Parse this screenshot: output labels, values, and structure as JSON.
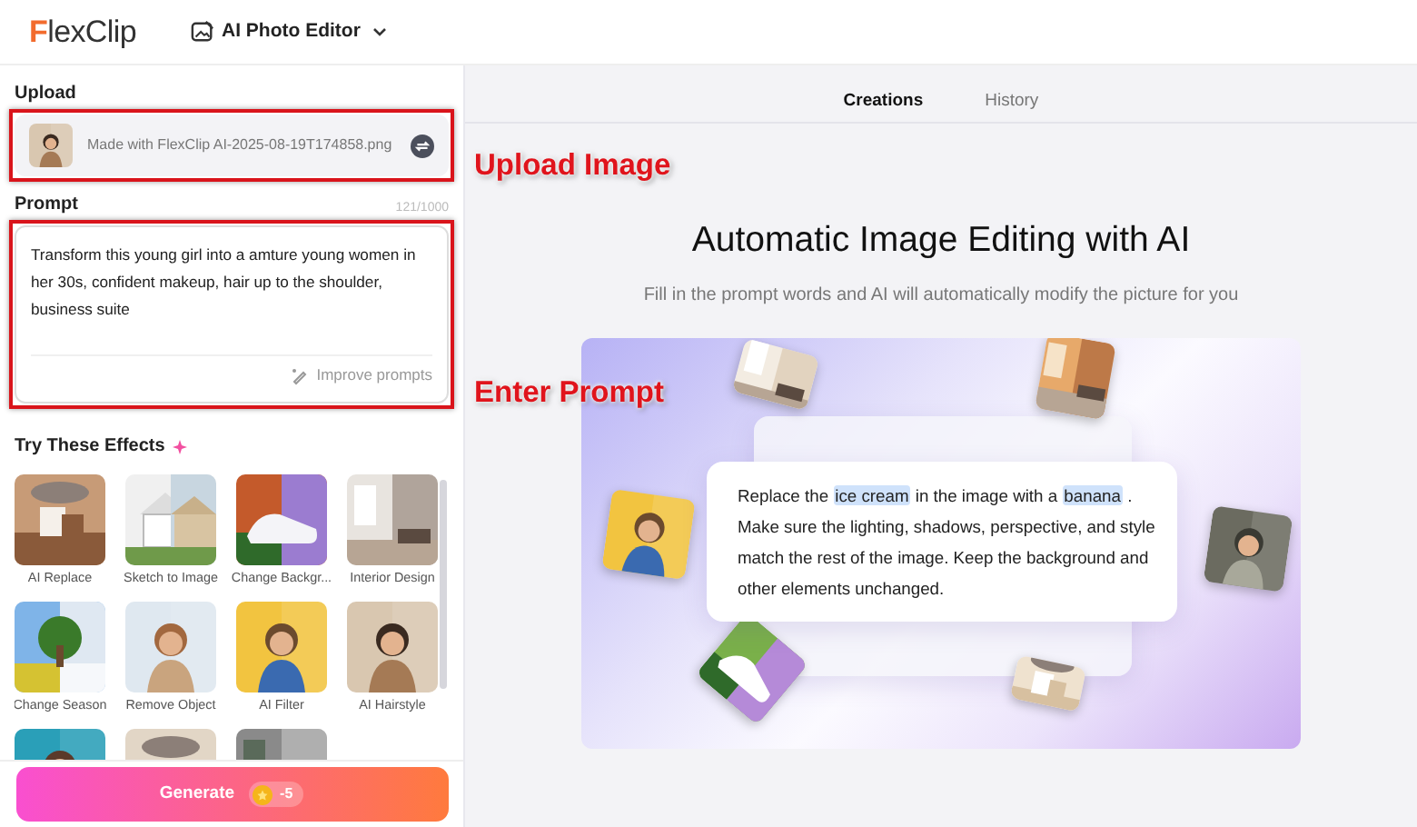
{
  "header": {
    "logo": "FlexClip",
    "tool_menu": "AI Photo Editor"
  },
  "upload": {
    "label": "Upload",
    "annotation": "Upload Image",
    "file_name": "Made with FlexClip AI-2025-08-19T174858.png"
  },
  "prompt": {
    "label": "Prompt",
    "annotation": "Enter Prompt",
    "counter": "121/1000",
    "value": "Transform this young girl into a amture young women in her 30s, confident makeup, hair up to the shoulder, business suite",
    "improve_button": "Improve prompts"
  },
  "effects": {
    "title": "Try These Effects",
    "items": [
      {
        "kind": "labeled",
        "label": "AI Replace"
      },
      {
        "kind": "labeled",
        "label": "Sketch to Image"
      },
      {
        "kind": "labeled",
        "label": "Change Backgr..."
      },
      {
        "kind": "labeled",
        "label": "Interior Design"
      },
      {
        "kind": "labeled",
        "label": "Change Season"
      },
      {
        "kind": "labeled",
        "label": "Remove Object"
      },
      {
        "kind": "labeled",
        "label": "AI Filter"
      },
      {
        "kind": "labeled",
        "label": "AI Hairstyle"
      },
      {
        "kind": "cut"
      },
      {
        "kind": "cut"
      },
      {
        "kind": "cut"
      }
    ]
  },
  "generate": {
    "label": "Generate",
    "cost": "-5"
  },
  "tabs": [
    {
      "label": "Creations",
      "selected": true
    },
    {
      "label": "History",
      "selected": false
    }
  ],
  "hero": {
    "title": "Automatic Image Editing with AI",
    "subtitle": "Fill in the prompt words and AI will automatically modify the picture for you",
    "example": [
      {
        "text": "Replace the ",
        "highlighted": false
      },
      {
        "text": "ice cream",
        "highlighted": true
      },
      {
        "text": " in the image with a ",
        "highlighted": false
      },
      {
        "text": "banana",
        "highlighted": true
      },
      {
        "text": " . Make sure the lighting, shadows, perspective, and style match the rest of the image. Keep the background and other elements unchanged.",
        "highlighted": false
      }
    ]
  }
}
